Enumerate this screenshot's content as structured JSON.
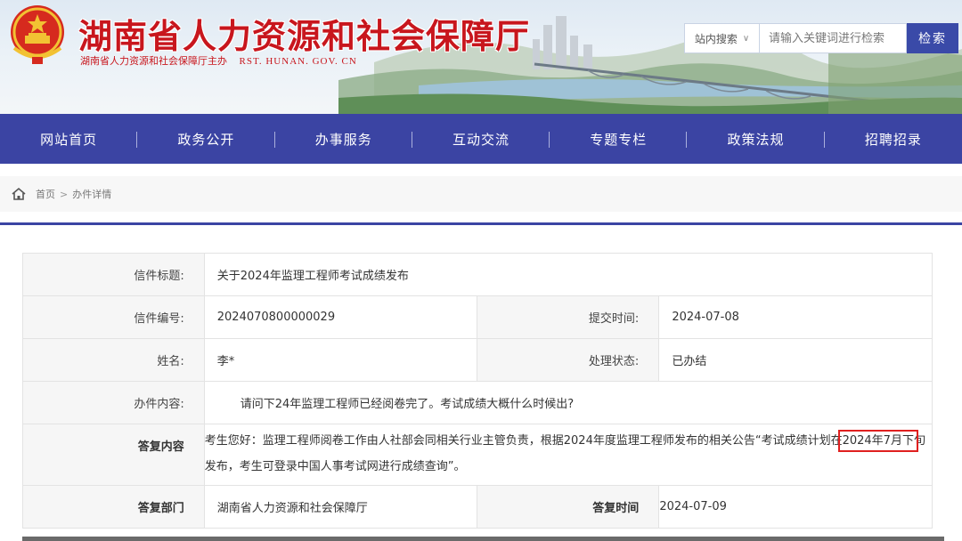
{
  "header": {
    "title": "湖南省人力资源和社会保障厅",
    "subtitle": "湖南省人力资源和社会保障厅主办",
    "domain": "RST. HUNAN. GOV. CN",
    "search": {
      "scope_label": "站内搜索",
      "placeholder": "请输入关键词进行检索",
      "button_label": "检索"
    }
  },
  "nav": {
    "items": [
      {
        "label": "网站首页"
      },
      {
        "label": "政务公开"
      },
      {
        "label": "办事服务"
      },
      {
        "label": "互动交流"
      },
      {
        "label": "专题专栏"
      },
      {
        "label": "政策法规"
      },
      {
        "label": "招聘招录"
      }
    ]
  },
  "breadcrumb": {
    "home": "首页",
    "separator": ">",
    "current": "办件详情"
  },
  "detail": {
    "subject_label": "信件标题:",
    "subject_value": "关于2024年监理工程师考试成绩发布",
    "number_label": "信件编号:",
    "number_value": "2024070800000029",
    "submit_time_label": "提交时间:",
    "submit_time_value": "2024-07-08",
    "name_label": "姓名:",
    "name_value": "李*",
    "status_label": "处理状态:",
    "status_value": "已办结",
    "content_label": "办件内容:",
    "content_value": "请问下24年监理工程师已经阅卷完了。考试成绩大概什么时候出?",
    "reply_label": "答复内容",
    "reply_part1": "考生您好：监理工程师阅卷工作由人社部会同相关行业主管负责，根据2024年度监理工程师发布的相关公告“考试成绩计划在",
    "reply_highlight": "2024年7月下",
    "reply_part2": "旬发布，考生可登录中国人事考试网进行成绩查询”。",
    "dept_label": "答复部门",
    "dept_value": "湖南省人力资源和社会保障厅",
    "reply_time_label": "答复时间",
    "reply_time_value": "2024-07-09"
  },
  "colors": {
    "nav_bg": "#3b44a3",
    "title_red": "#c8161d",
    "highlight_border": "#e0201f"
  }
}
